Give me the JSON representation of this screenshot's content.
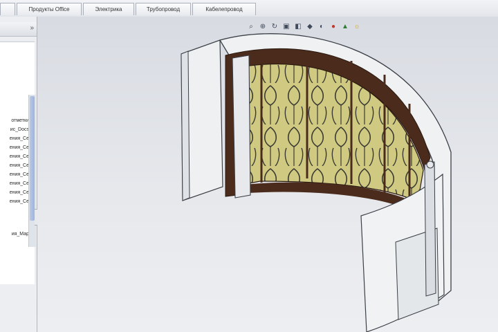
{
  "tabs": [
    {
      "label": "",
      "name": "tab-sketch"
    },
    {
      "label": "Продукты Office",
      "name": "tab-office-products"
    },
    {
      "label": "Электрика",
      "name": "tab-electrical"
    },
    {
      "label": "Трубопровод",
      "name": "tab-piping"
    },
    {
      "label": "Кабелепровод",
      "name": "tab-conduit"
    }
  ],
  "tree": {
    "items": [
      "отметки",
      "ис_Docs",
      "ения_Се",
      "ения_Се",
      "ения_Се",
      "ения_Се",
      "ения_Се",
      "ения_Се",
      "ения_Се",
      "ения_Се",
      "ия_Мар"
    ]
  },
  "hud_icons": [
    "zoom-to-fit-icon",
    "zoom-area-icon",
    "rotate-icon",
    "view-orientation-icon",
    "section-view-icon",
    "display-style-icon",
    "hide-show-icon",
    "edit-appearance-icon",
    "apply-scene-icon",
    "view-settings-icon"
  ],
  "colors": {
    "frame_wood": "#4a2b1c",
    "glass": "#c9c37a",
    "lattice": "#3a3a32",
    "wall": "#eef0f2",
    "edge": "#3b3f46"
  }
}
